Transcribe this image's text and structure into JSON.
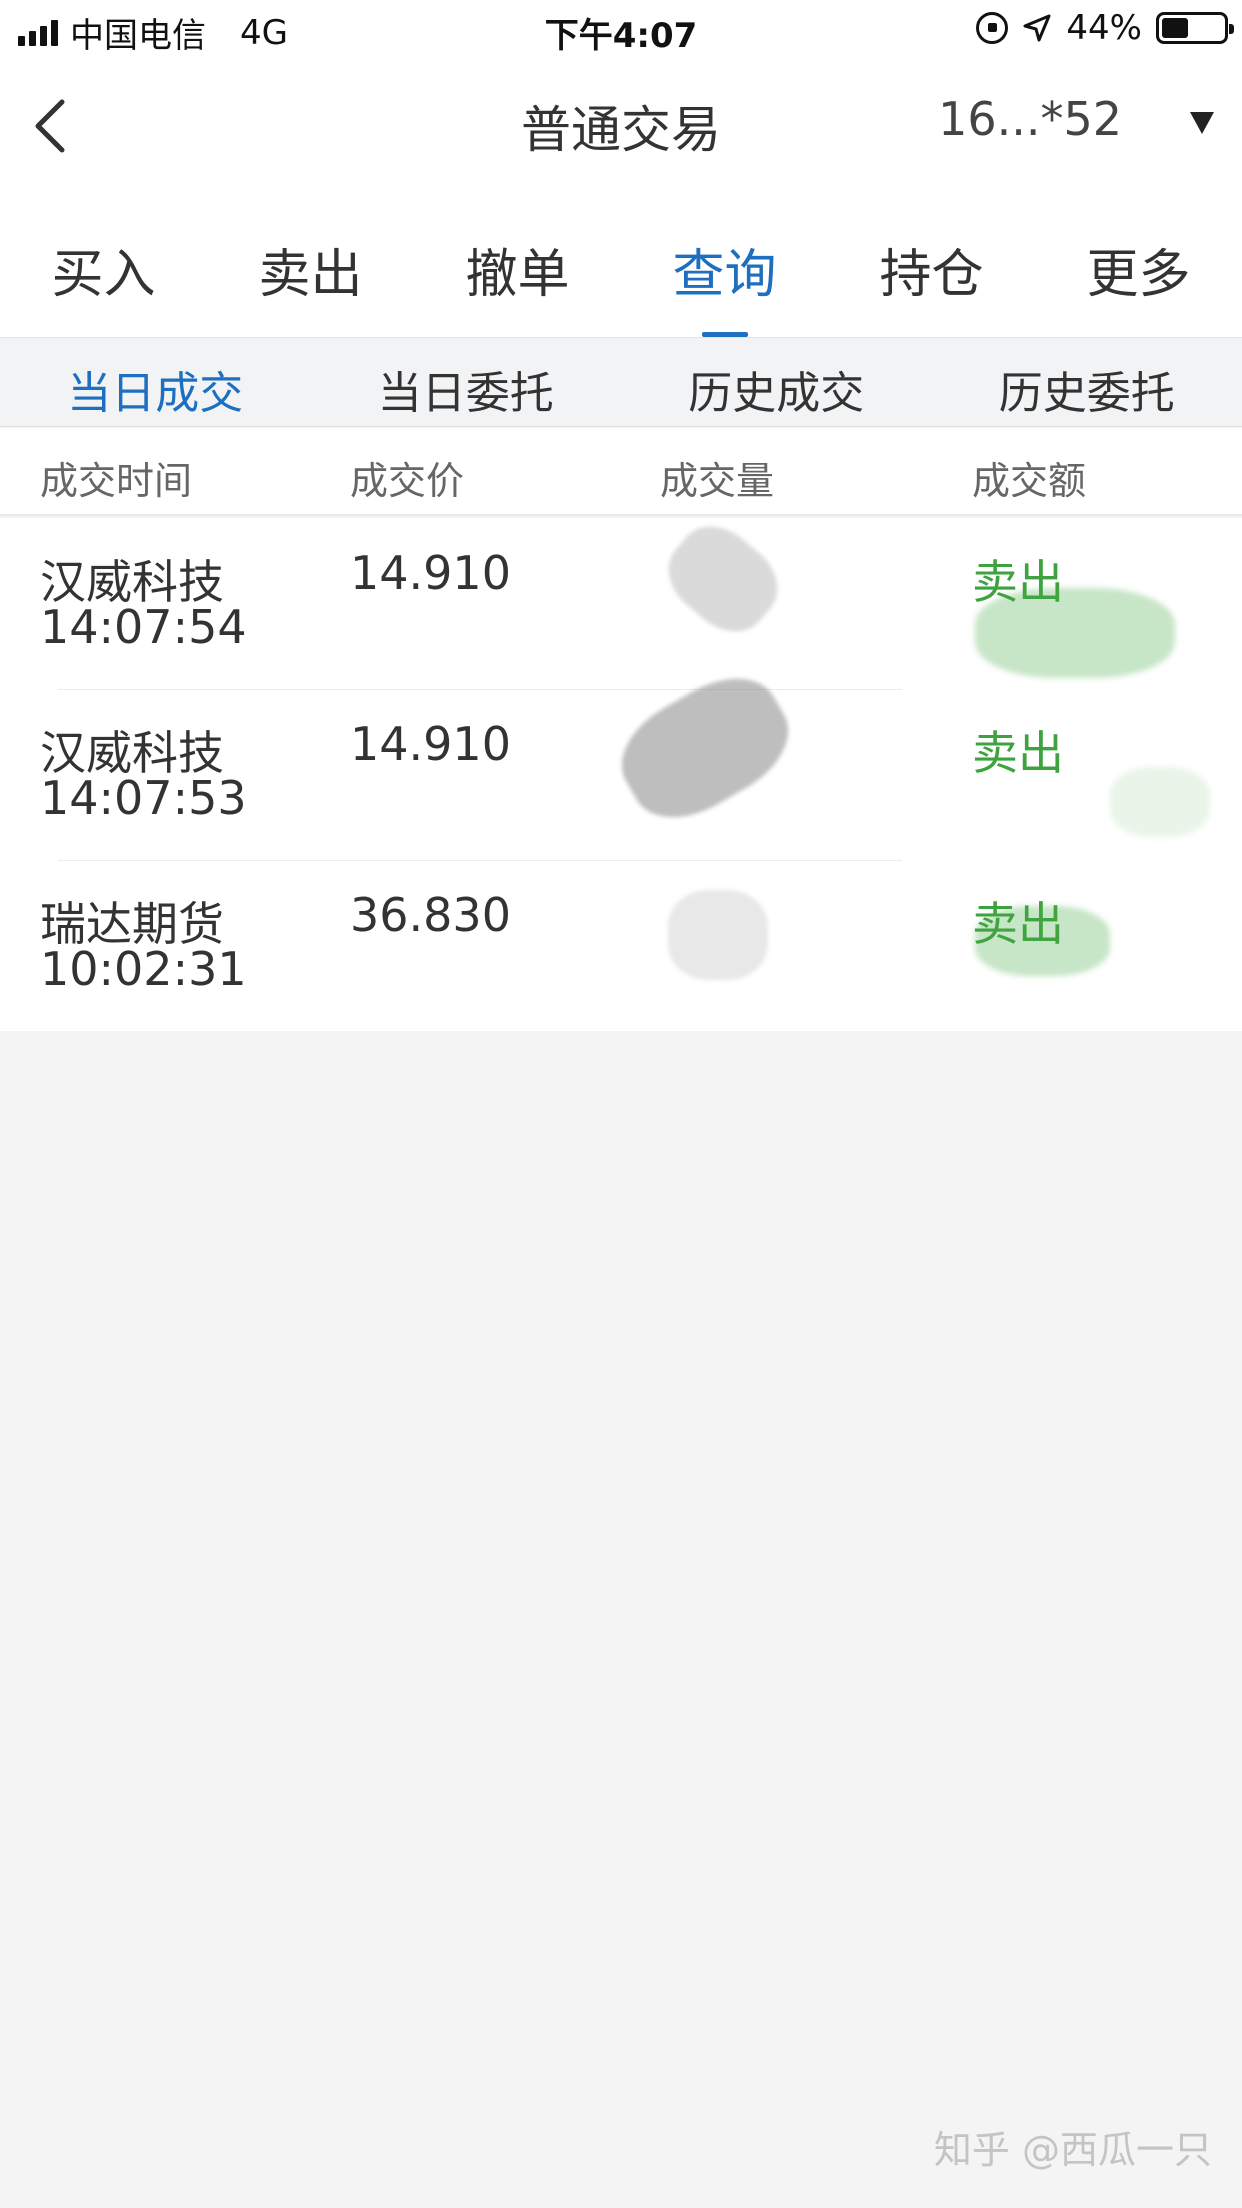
{
  "status_bar": {
    "carrier": "中国电信",
    "network": "4G",
    "time": "下午4:07",
    "battery_percent_text": "44%",
    "battery_level": 0.44
  },
  "nav": {
    "title": "普通交易",
    "account": "16...*52"
  },
  "main_tabs": [
    {
      "label": "买入"
    },
    {
      "label": "卖出"
    },
    {
      "label": "撤单"
    },
    {
      "label": "查询",
      "active": true
    },
    {
      "label": "持仓"
    },
    {
      "label": "更多"
    }
  ],
  "sub_tabs": [
    {
      "label": "当日成交",
      "active": true
    },
    {
      "label": "当日委托"
    },
    {
      "label": "历史成交"
    },
    {
      "label": "历史委托"
    }
  ],
  "columns": [
    "成交时间",
    "成交价",
    "成交量",
    "成交额"
  ],
  "rows": [
    {
      "name": "汉威科技",
      "time": "14:07:54",
      "price": "14.910",
      "side": "卖出"
    },
    {
      "name": "汉威科技",
      "time": "14:07:53",
      "price": "14.910",
      "side": "卖出"
    },
    {
      "name": "瑞达期货",
      "time": "10:02:31",
      "price": "36.830",
      "side": "卖出"
    }
  ],
  "watermark": "知乎 @西瓜一只",
  "colors": {
    "accent": "#1e6fc0",
    "sell_green": "#3ea33e",
    "background": "#f4f4f4"
  }
}
